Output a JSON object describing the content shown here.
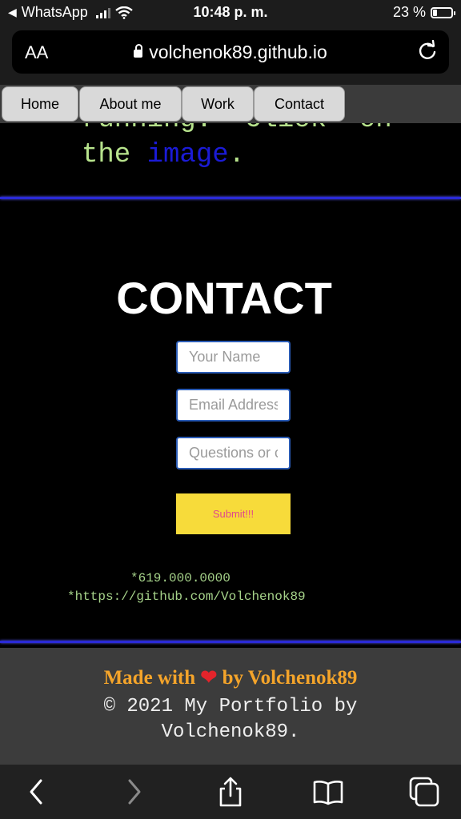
{
  "status_bar": {
    "back_app": "WhatsApp",
    "time": "10:48 p. m.",
    "battery": "23 %",
    "battery_level": 0.23
  },
  "browser": {
    "text_size_label": "AA",
    "url": "volchenok89.github.io"
  },
  "nav": {
    "items": [
      "Home",
      "About me",
      "Work",
      "Contact"
    ]
  },
  "previous_section": {
    "line1": "running.  Click  on",
    "line2_prefix": "the ",
    "line2_link": "image",
    "line2_suffix": "."
  },
  "contact": {
    "title": "CONTACT",
    "name_placeholder": "Your Name",
    "email_placeholder": "Email Address",
    "questions_placeholder": "Questions or comments",
    "submit_label": "Submit!!!",
    "phone": "*619.000.0000",
    "github": "*https://github.com/Volchenok89"
  },
  "footer": {
    "made_prefix": "Made with ",
    "heart": "❤",
    "made_suffix": " by Volchenok89",
    "copyright_line1": "© 2021 My Portfolio by",
    "copyright_line2": "Volchenok89."
  },
  "colors": {
    "accent_divider": "#2a2ad8",
    "submit_bg": "#f7db3a",
    "footer_made": "#f4a42a",
    "code_text": "#b7e38c"
  },
  "icons": [
    "back-triangle-icon",
    "signal-icon",
    "wifi-icon",
    "battery-icon",
    "lock-icon",
    "reload-icon",
    "back-icon",
    "forward-icon",
    "share-icon",
    "bookmarks-icon",
    "tabs-icon"
  ]
}
